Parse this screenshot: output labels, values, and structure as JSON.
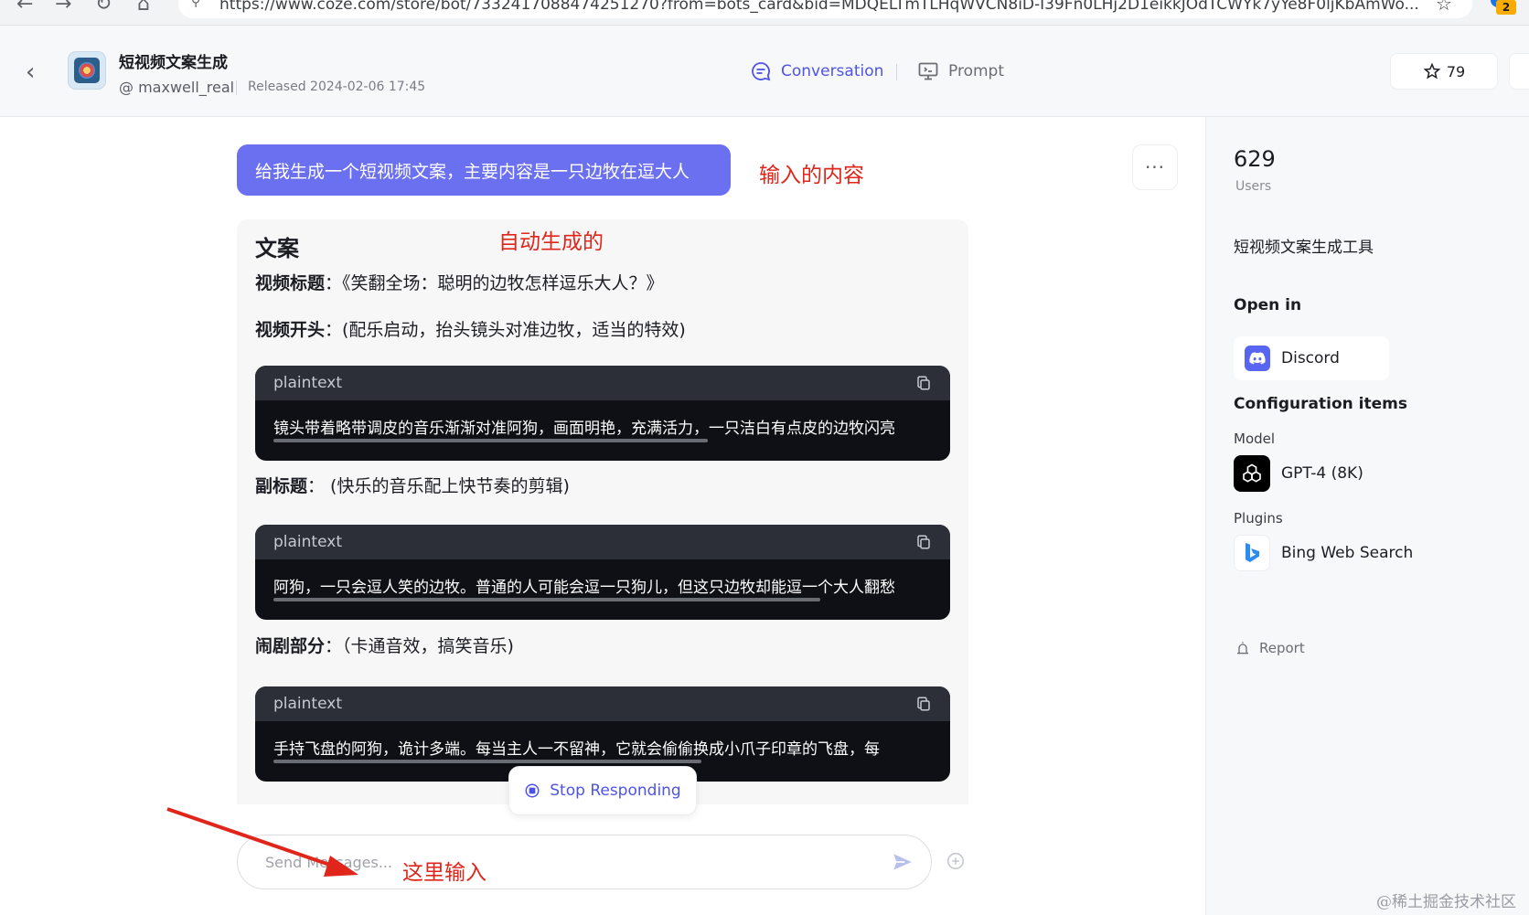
{
  "browser": {
    "url": "https://www.coze.com/store/bot/7332417088474251270?from=bots_card&bid=MDQELTmTLHqWVCN8iD-I39Fn0LHj2D1eikkJOdTCWYk7yYe8F0ljKbAmWo...",
    "extension_badge": "2"
  },
  "header": {
    "back_label": "‹",
    "bot_name": "短视频文案生成",
    "author": "@ maxwell_real",
    "released": "Released 2024-02-06 17:45",
    "tabs": [
      {
        "label": "Conversation",
        "active": true
      },
      {
        "label": "Prompt",
        "active": false
      }
    ],
    "star_count": "79"
  },
  "chat": {
    "user_message": "给我生成一个短视频文案，主要内容是一只边牧在逗大人",
    "more_label": "···",
    "reply": {
      "title": "文案",
      "lines": [
        {
          "label": "视频标题",
          "text": "：《笑翻全场：聪明的边牧怎样逗乐大人？》"
        },
        {
          "label": "视频开头",
          "text": "：(配乐启动，抬头镜头对准边牧，适当的特效)"
        },
        {
          "label": "副标题",
          "text": "：  (快乐的音乐配上快节奏的剪辑)"
        },
        {
          "label": "闹剧部分",
          "text": "：（卡通音效，搞笑音乐)"
        }
      ],
      "code_blocks": [
        {
          "lang": "plaintext",
          "text": "镜头带着略带调皮的音乐渐渐对准阿狗，画面明艳，充满活力，一只洁白有点皮的边牧闪亮",
          "scroll": 0.66
        },
        {
          "lang": "plaintext",
          "text": "阿狗，一只会逗人笑的边牧。普通的人可能会逗一只狗儿，但这只边牧却能逗一个大人翻愁",
          "scroll": 0.83
        },
        {
          "lang": "plaintext",
          "text": "手持飞盘的阿狗，诡计多端。每当主人一不留神，它就会偷偷换成小爪子印章的飞盘，每",
          "scroll": 0.65
        }
      ]
    },
    "stop_label": "Stop Responding",
    "input_placeholder": "Send Messages..."
  },
  "sidebar": {
    "users_count": "629",
    "users_label": "Users",
    "description": "短视频文案生成工具",
    "open_in_title": "Open in",
    "discord_label": "Discord",
    "config_title": "Configuration items",
    "model_label": "Model",
    "model_name": "GPT-4 (8K)",
    "plugins_label": "Plugins",
    "plugin_name": "Bing Web Search",
    "report_label": "Report"
  },
  "annotations": {
    "input_content": "输入的内容",
    "auto_generated": "自动生成的",
    "input_here": "这里输入"
  },
  "watermark": "@稀土掘金技术社区",
  "colors": {
    "accent": "#4d53e8",
    "user_bubble": "#6b70f0",
    "annotation_red": "#e0251b",
    "code_bg": "#0f1015",
    "code_header": "#2d2f38"
  }
}
